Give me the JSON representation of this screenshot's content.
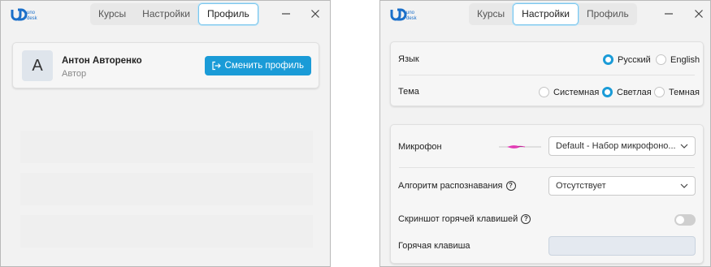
{
  "app": {
    "brand_text": "uno desk",
    "tabs": {
      "courses": "Курсы",
      "settings": "Настройки",
      "profile": "Профиль"
    }
  },
  "profile_window": {
    "active_tab": "Профиль",
    "avatar_letter": "A",
    "user_name": "Антон Авторенко",
    "user_role": "Автор",
    "switch_profile_label": "Сменить профиль"
  },
  "settings_window": {
    "active_tab": "Настройки",
    "language": {
      "label": "Язык",
      "options": [
        {
          "label": "Русский",
          "selected": true
        },
        {
          "label": "English",
          "selected": false
        }
      ]
    },
    "theme": {
      "label": "Тема",
      "options": [
        {
          "label": "Системная",
          "selected": false
        },
        {
          "label": "Светлая",
          "selected": true
        },
        {
          "label": "Темная",
          "selected": false
        }
      ]
    },
    "microphone": {
      "label": "Микрофон",
      "value": "Default - Набор микрофоно..."
    },
    "recognition": {
      "label": "Алгоритм распознавания",
      "value": "Отсутствует"
    },
    "screenshot_hotkey": {
      "label": "Скриншот горячей клавишей",
      "enabled": false
    },
    "hotkey": {
      "label": "Горячая клавиша",
      "value": ""
    }
  },
  "colors": {
    "accent": "#1a9bd7",
    "window_bg": "#f2f2f2",
    "card_bg": "#f6f6f6"
  }
}
